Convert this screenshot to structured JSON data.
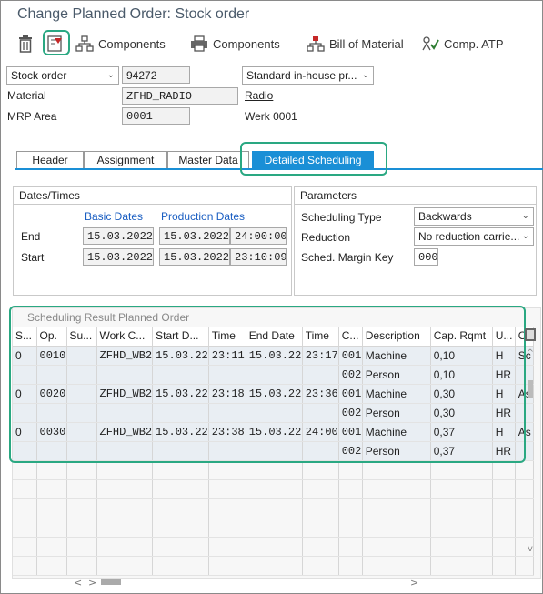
{
  "window": {
    "title": "Change Planned Order: Stock order"
  },
  "toolbar": {
    "delete_icon": "trash-icon",
    "components_1": "Components",
    "components_2": "Components",
    "bill_of_material": "Bill of Material",
    "comp_atp": "Comp. ATP"
  },
  "header_fields": {
    "order_type": "Stock order",
    "order_number": "94272",
    "procurement": "Standard in-house pr...",
    "material_label": "Material",
    "material_value": "ZFHD_RADIO",
    "material_desc": "Radio",
    "mrp_area_label": "MRP Area",
    "mrp_area_value": "0001",
    "mrp_area_desc": "Werk 0001"
  },
  "tabs": {
    "header": "Header",
    "assignment": "Assignment",
    "master_data": "Master Data",
    "detailed_scheduling": "Detailed Scheduling"
  },
  "dates_times": {
    "title": "Dates/Times",
    "basic_dates": "Basic Dates",
    "production_dates": "Production Dates",
    "end_label": "End",
    "end_basic": "15.03.2022",
    "end_prod_date": "15.03.2022",
    "end_prod_time": "24:00:00",
    "start_label": "Start",
    "start_basic": "15.03.2022",
    "start_prod_date": "15.03.2022",
    "start_prod_time": "23:10:09"
  },
  "parameters": {
    "title": "Parameters",
    "scheduling_type_label": "Scheduling Type",
    "scheduling_type_value": "Backwards",
    "reduction_label": "Reduction",
    "reduction_value": "No reduction carrie...",
    "sched_margin_label": "Sched. Margin Key",
    "sched_margin_value": "000"
  },
  "result_grid": {
    "title": "Scheduling Result Planned Order",
    "columns": [
      "S...",
      "Op.",
      "Su...",
      "Work C...",
      "Start D...",
      "Time",
      "End Date",
      "Time",
      "C...",
      "Description",
      "Cap. Rqmt",
      "U...",
      "O"
    ],
    "rows": [
      [
        "0",
        "0010",
        "",
        "ZFHD_WB2",
        "15.03.22",
        "23:11",
        "15.03.22",
        "23:17",
        "001",
        "Machine",
        "0,10",
        "H",
        "Sc"
      ],
      [
        "",
        "",
        "",
        "",
        "",
        "",
        "",
        "",
        "002",
        "Person",
        "0,10",
        "HR",
        ""
      ],
      [
        "0",
        "0020",
        "",
        "ZFHD_WB2",
        "15.03.22",
        "23:18",
        "15.03.22",
        "23:36",
        "001",
        "Machine",
        "0,30",
        "H",
        "As"
      ],
      [
        "",
        "",
        "",
        "",
        "",
        "",
        "",
        "",
        "002",
        "Person",
        "0,30",
        "HR",
        ""
      ],
      [
        "0",
        "0030",
        "",
        "ZFHD_WB2",
        "15.03.22",
        "23:38",
        "15.03.22",
        "24:00",
        "001",
        "Machine",
        "0,37",
        "H",
        "As"
      ],
      [
        "",
        "",
        "",
        "",
        "",
        "",
        "",
        "",
        "002",
        "Person",
        "0,37",
        "HR",
        ""
      ]
    ]
  },
  "colors": {
    "accent": "#1a8fd6",
    "highlight": "#2aa882",
    "link_blue": "#1a5ec2"
  }
}
